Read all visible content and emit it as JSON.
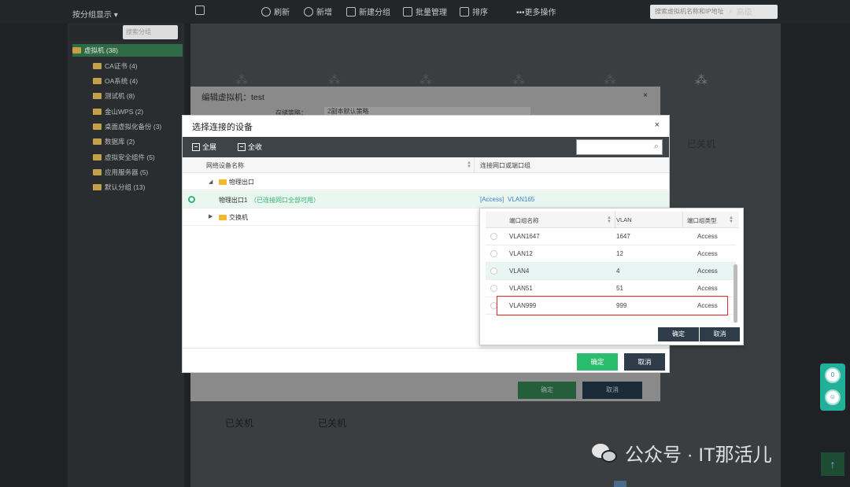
{
  "topbar": {
    "items": [
      "刷新",
      "新增",
      "新建分组",
      "批量管理",
      "排序",
      "•••更多操作"
    ],
    "search_placeholder": "搜索虚拟机名称和IP地址",
    "search_scope": "高级"
  },
  "sidebar": {
    "title": "按分组显示",
    "search_placeholder": "搜索分组",
    "root": "虚拟机 (38)",
    "groups": [
      "CA证书 (4)",
      "OA系统 (4)",
      "测试机 (8)",
      "金山WPS (2)",
      "桌面虚拟化备份 (3)",
      "数据库 (2)",
      "虚拟安全组件 (5)",
      "应用服务器 (5)",
      "默认分组 (13)"
    ]
  },
  "background": {
    "edit_dialog_title": "编辑虚拟机：test",
    "edit_dialog_field": "存储策略：",
    "edit_dialog_field_value": "2副本默认策略",
    "edit_ok": "确定",
    "edit_cancel": "取消",
    "powered_off": [
      "已关机",
      "已关机",
      "已关机"
    ]
  },
  "dialog": {
    "title": "选择连接的设备",
    "close": "×",
    "expand_all": "全展",
    "collapse_all": "全收",
    "col_device": "网络设备名称",
    "col_port_group": "连接网口或端口组",
    "rows": [
      {
        "name": "物理出口",
        "type": "folder",
        "expanded": true
      },
      {
        "name": "物理出口1",
        "note": "（已连接网口全部可用）",
        "selected": true,
        "value_type": "[Access]",
        "value": "VLAN165"
      },
      {
        "name": "交换机",
        "type": "folder",
        "expanded": false
      }
    ],
    "ok": "确定",
    "cancel": "取消"
  },
  "popup": {
    "col_name": "端口组名称",
    "col_vlan": "VLAN",
    "col_type": "端口组类型",
    "rows": [
      {
        "name": "VLAN1647",
        "vlan": "1647",
        "type": "Access",
        "hover": false
      },
      {
        "name": "VLAN12",
        "vlan": "12",
        "type": "Access",
        "hover": false
      },
      {
        "name": "VLAN4",
        "vlan": "4",
        "type": "Access",
        "hover": true
      },
      {
        "name": "VLAN51",
        "vlan": "51",
        "type": "Access",
        "hover": false
      },
      {
        "name": "VLAN999",
        "vlan": "999",
        "type": "Access",
        "hover": false
      }
    ],
    "ok": "确定",
    "cancel": "取消"
  },
  "widget": {
    "badge": "0",
    "back_to_top": "↑"
  },
  "watermark": "公众号 · IT那活儿",
  "colors": {
    "accent": "#2bbd6e",
    "dark_button": "#2f3d4a",
    "highlight": "#e62a2a",
    "toolbar": "#3e4347"
  }
}
